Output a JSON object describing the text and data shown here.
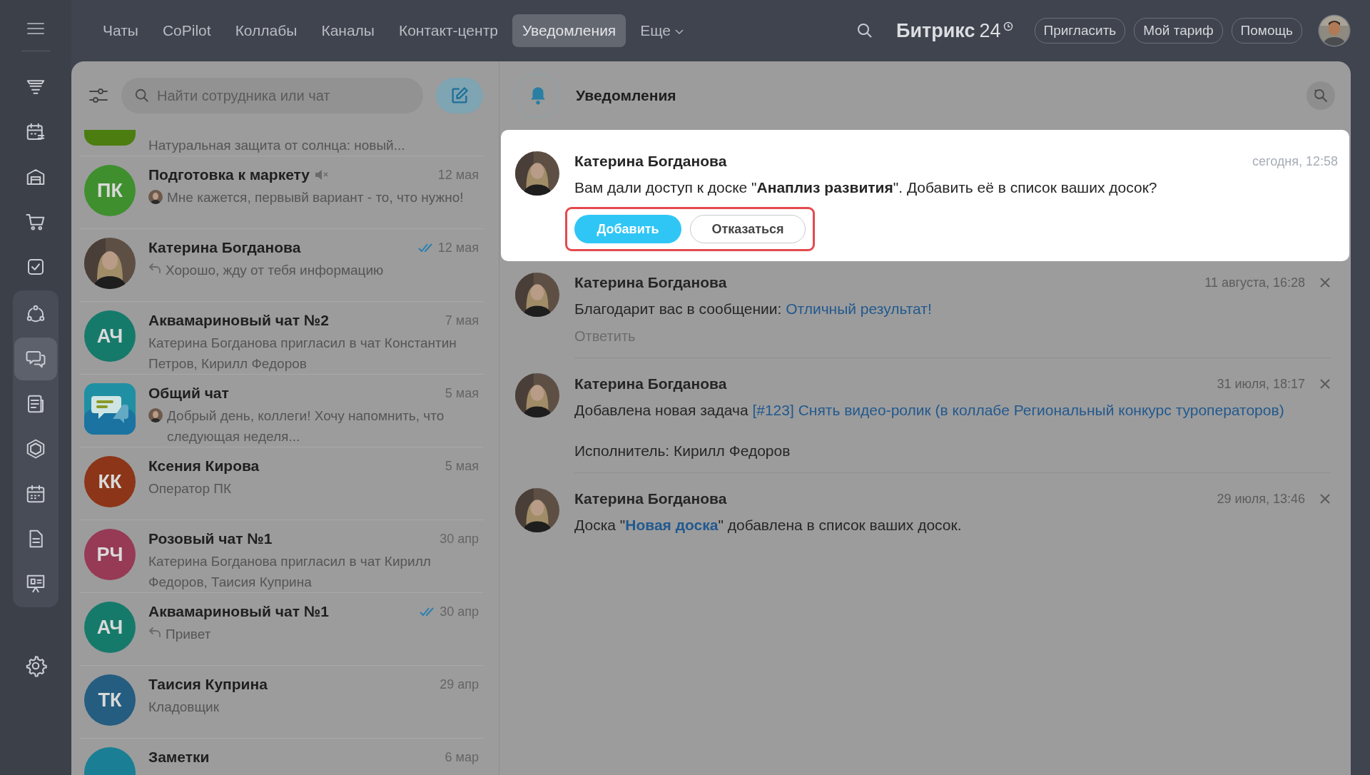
{
  "top_nav": {
    "tabs": [
      {
        "label": "Чаты",
        "selected": false
      },
      {
        "label": "CoPilot",
        "selected": false
      },
      {
        "label": "Коллабы",
        "selected": false
      },
      {
        "label": "Каналы",
        "selected": false
      },
      {
        "label": "Контакт-центр",
        "selected": false
      },
      {
        "label": "Уведомления",
        "selected": true
      },
      {
        "label": "Еще",
        "selected": false,
        "dropdown": true
      }
    ],
    "logo": {
      "name": "Битрикс",
      "number": "24"
    },
    "buttons": [
      "Пригласить",
      "Мой тариф",
      "Помощь"
    ]
  },
  "sidebar": {
    "items": [
      {
        "kind": "stack",
        "selected": false
      },
      {
        "kind": "calendar-list",
        "selected": false
      },
      {
        "kind": "building",
        "selected": false
      },
      {
        "kind": "cart",
        "selected": false
      },
      {
        "kind": "task",
        "selected": false
      },
      {
        "kind": "nodes",
        "selected": false
      },
      {
        "kind": "chat",
        "selected": true
      },
      {
        "kind": "news",
        "selected": false
      },
      {
        "kind": "hexagon",
        "selected": false
      },
      {
        "kind": "calendar",
        "selected": false
      },
      {
        "kind": "document",
        "selected": false
      },
      {
        "kind": "board",
        "selected": false
      }
    ]
  },
  "chat_list": {
    "search": {
      "placeholder": "Найти сотрудника или чат"
    },
    "chats": [
      {
        "avatar": {
          "kind": "partial",
          "color": "#4c7d10"
        },
        "preview": {
          "kind": "plain",
          "text": "Натуральная защита от солнца: новый..."
        }
      },
      {
        "name": "Подготовка к маркету",
        "muted": true,
        "read": false,
        "date": "12 мая",
        "preview": {
          "text": "Мне кажется, первывй вариант - то, что нужно!"
        },
        "avatar": {
          "kind": "initials",
          "initials": "ПК",
          "color": "#3f8f2f"
        }
      },
      {
        "name": "Катерина Богданова",
        "muted": false,
        "read": true,
        "date": "12 мая",
        "preview": {
          "kind": "reply",
          "text": "Хорошо, жду от тебя информацию"
        }
      },
      {
        "name": "Аквамариновый чат №2",
        "muted": false,
        "read": false,
        "date": "7 мая",
        "preview": {
          "kind": "plain",
          "text": "Катерина Богданова пригласил в чат Константин Петров, Кирилл Федоров"
        },
        "avatar": {
          "kind": "initials",
          "initials": "АЧ",
          "color": "#167a6b"
        }
      },
      {
        "name": "Общий чат",
        "muted": false,
        "read": false,
        "date": "5 мая",
        "preview": {
          "text": "Добрый день, коллеги! Хочу напомнить, что следующая неделя..."
        },
        "avatar": {
          "kind": "group"
        }
      },
      {
        "name": "Ксения Кирова",
        "muted": false,
        "read": false,
        "date": "5 мая",
        "preview": {
          "kind": "plain",
          "text": "Оператор ПК"
        },
        "avatar": {
          "kind": "initials",
          "initials": "КК",
          "color": "#8c3518"
        }
      },
      {
        "name": "Розовый чат №1",
        "muted": false,
        "read": false,
        "date": "30 апр",
        "preview": {
          "kind": "plain",
          "text": "Катерина Богданова пригласил в чат Кирилл Федоров, Таисия Куприна"
        },
        "avatar": {
          "kind": "initials",
          "initials": "РЧ",
          "color": "#963a55"
        }
      },
      {
        "name": "Аквамариновый чат №1",
        "muted": false,
        "read": true,
        "date": "30 апр",
        "preview": {
          "kind": "reply",
          "text": "Привет"
        },
        "avatar": {
          "kind": "initials",
          "initials": "АЧ",
          "color": "#167a6b"
        }
      },
      {
        "name": "Таисия Куприна",
        "muted": false,
        "read": false,
        "date": "29 апр",
        "preview": {
          "kind": "plain",
          "text": "Кладовщик"
        },
        "avatar": {
          "kind": "initials",
          "initials": "ТК",
          "color": "#245d80"
        }
      },
      {
        "name": "Заметки",
        "muted": false,
        "read": false,
        "date": "6 мар",
        "avatar": {
          "kind": "initials",
          "color": "#1a7f95"
        }
      }
    ]
  },
  "notifications": {
    "title": "Уведомления",
    "items": [
      {
        "highlighted": true,
        "author": "Катерина Богданова",
        "time": "сегодня, 12:58",
        "parts": [
          {
            "text": "Вам дали доступ к доске \"**Анаплиз развития**\". Добавить её в список ваших досок?",
            "link": false,
            "bold": false
          }
        ],
        "buttons": [
          {
            "label": "Добавить",
            "kind": "primary"
          },
          {
            "label": "Отказаться",
            "kind": "secondary"
          }
        ]
      },
      {
        "highlighted": false,
        "author": "Катерина Богданова",
        "time": "11 августа, 16:28",
        "parts": [
          {
            "text": "Благодарит вас в сообщении: ",
            "link": false,
            "bold": false
          },
          {
            "text": "Отличный результат!",
            "link": true,
            "bold": false
          }
        ],
        "reply_label": "Ответить"
      },
      {
        "highlighted": false,
        "author": "Катерина Богданова",
        "time": "31 июля, 18:17",
        "parts": [
          {
            "text": "Добавлена новая задача ",
            "link": false,
            "bold": false
          },
          {
            "text": "[#123] Снять видео-ролик (в коллабе Региональный конкурс туроператоров)",
            "link": true,
            "bold": false
          }
        ],
        "extra_line": "Исполнитель: Кирилл Федоров"
      },
      {
        "highlighted": false,
        "author": "Катерина Богданова",
        "time": "29 июля, 13:46",
        "parts": [
          {
            "text": "Доска \"",
            "link": false,
            "bold": false
          },
          {
            "text": "Новая доска",
            "link": true,
            "bold": true
          },
          {
            "text": "\" добавлена в список ваших досок.",
            "link": false,
            "bold": false
          }
        ]
      }
    ]
  }
}
